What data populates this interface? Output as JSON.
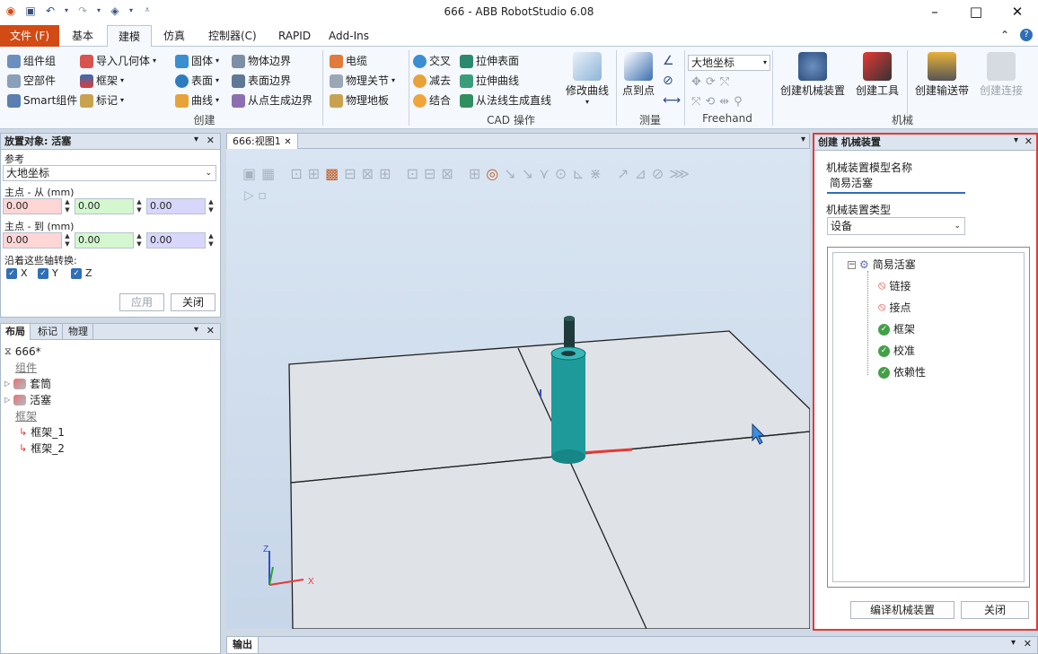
{
  "window": {
    "title": "666 - ABB RobotStudio 6.08"
  },
  "tabs": [
    "基本",
    "建模",
    "仿真",
    "控制器(C)",
    "RAPID",
    "Add-Ins"
  ],
  "file_tab": "文件 (F)",
  "ribbon": {
    "create": {
      "items": [
        "组件组",
        "空部件",
        "Smart组件",
        "导入几何体",
        "框架",
        "标记",
        "固体",
        "表面",
        "曲线",
        "物体边界",
        "表面边界",
        "从点生成边界"
      ],
      "group": "创建"
    },
    "cad": {
      "items": [
        "电缆",
        "物理关节",
        "物理地板",
        "交叉",
        "减去",
        "结合",
        "拉伸表面",
        "拉伸曲线",
        "从法线生成直线"
      ],
      "modify_curve": "修改曲线",
      "group": "CAD 操作"
    },
    "measure": {
      "point_to_point": "点到点",
      "group": "测量"
    },
    "freehand": {
      "coord": "大地坐标",
      "group": "Freehand"
    },
    "mechanism": {
      "create_mechanism": "创建机械装置",
      "create_tool": "创建工具",
      "create_conveyor": "创建输送带",
      "create_connection": "创建连接",
      "group": "机械"
    }
  },
  "place_panel": {
    "title": "放置对象: 活塞",
    "reference_label": "参考",
    "reference_value": "大地坐标",
    "from_label": "主点 - 从 (mm)",
    "from_values": [
      "0.00",
      "0.00",
      "0.00"
    ],
    "to_label": "主点 - 到 (mm)",
    "to_values": [
      "0.00",
      "0.00",
      "0.00"
    ],
    "axes_label": "沿着这些轴转换:",
    "axes": [
      "X",
      "Y",
      "Z"
    ],
    "apply": "应用",
    "close": "关闭"
  },
  "layout_panel": {
    "tabs": [
      "布局",
      "标记",
      "物理"
    ],
    "station": "666*",
    "components_header": "组件",
    "components": [
      "套筒",
      "活塞"
    ],
    "frames_header": "框架",
    "frames": [
      "框架_1",
      "框架_2"
    ]
  },
  "viewport": {
    "tab": "666:视图1"
  },
  "mechanism_panel": {
    "title": "创建 机械装置",
    "name_label": "机械装置模型名称",
    "name_value": "简易活塞",
    "type_label": "机械装置类型",
    "type_value": "设备",
    "tree_root": "简易活塞",
    "tree_items": [
      {
        "label": "链接",
        "status": "error"
      },
      {
        "label": "接点",
        "status": "error"
      },
      {
        "label": "框架",
        "status": "ok"
      },
      {
        "label": "校准",
        "status": "ok"
      },
      {
        "label": "依赖性",
        "status": "ok"
      }
    ],
    "compile": "编译机械装置",
    "close": "关闭"
  },
  "output_panel": {
    "tab": "输出"
  },
  "colors": {
    "accent": "#d24a14",
    "highlight": "#e53935",
    "from_x": "#ffd6d6",
    "from_y": "#d4f7d0",
    "from_z": "#d9d6fb"
  }
}
